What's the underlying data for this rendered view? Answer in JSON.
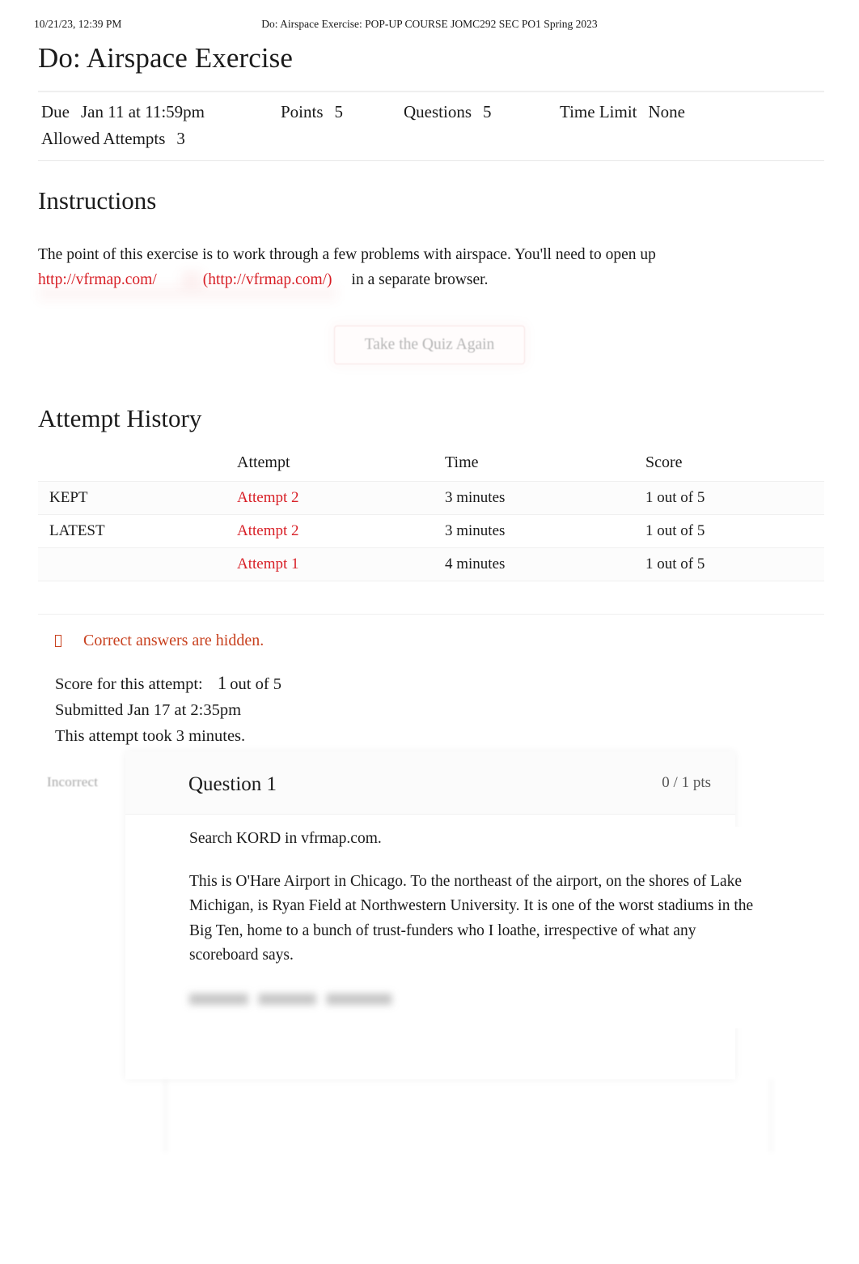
{
  "print_header": {
    "date": "10/21/23, 12:39 PM",
    "title": "Do: Airspace Exercise: POP-UP COURSE JOMC292 SEC PO1 Spring 2023"
  },
  "page_title": "Do: Airspace Exercise",
  "quiz_meta": {
    "due_label": "Due",
    "due_value": "Jan 11 at 11:59pm",
    "points_label": "Points",
    "points_value": "5",
    "questions_label": "Questions",
    "questions_value": "5",
    "time_limit_label": "Time Limit",
    "time_limit_value": "None",
    "allowed_attempts_label": "Allowed Attempts",
    "allowed_attempts_value": "3"
  },
  "instructions": {
    "heading": "Instructions",
    "text_before_link": "The point of this exercise is to work through a few problems with airspace. You'll need to open up",
    "link_text": "http://vfrmap.com/",
    "link_url_text": "(http://vfrmap.com/)",
    "text_after_link": "in a separate browser."
  },
  "take_quiz_again_button": "Take the Quiz Again",
  "attempt_history": {
    "heading": "Attempt History",
    "columns": [
      "",
      "Attempt",
      "Time",
      "Score"
    ],
    "rows": [
      {
        "status": "KEPT",
        "attempt": "Attempt 2",
        "time": "3 minutes",
        "score": "1 out of 5"
      },
      {
        "status": "LATEST",
        "attempt": "Attempt 2",
        "time": "3 minutes",
        "score": "1 out of 5"
      },
      {
        "status": "",
        "attempt": "Attempt 1",
        "time": "4 minutes",
        "score": "1 out of 5"
      }
    ]
  },
  "answers_hidden_notice": "Correct answers are hidden.",
  "attempt_summary": {
    "score_label": "Score for this attempt:",
    "score_value": "1",
    "score_suffix": "out of 5",
    "submitted": "Submitted Jan 17 at 2:35pm",
    "duration": "This attempt took 3 minutes."
  },
  "question": {
    "flag": "Incorrect",
    "name": "Question 1",
    "points": "0 / 1 pts",
    "paragraphs": [
      "Search KORD in vfrmap.com.",
      "This is O'Hare Airport in Chicago. To the northeast of the airport, on the shores of Lake Michigan, is Ryan Field at Northwestern University. It is one of the worst stadiums in the Big Ten, home to a bunch of trust-funders who I loathe, irrespective of what any scoreboard says."
    ],
    "redacted_paragraph": ""
  },
  "colors": {
    "link_red": "#d81f26",
    "notice_orange": "#c8411f",
    "text": "#1a1a1a",
    "muted": "#a6a6a6"
  }
}
